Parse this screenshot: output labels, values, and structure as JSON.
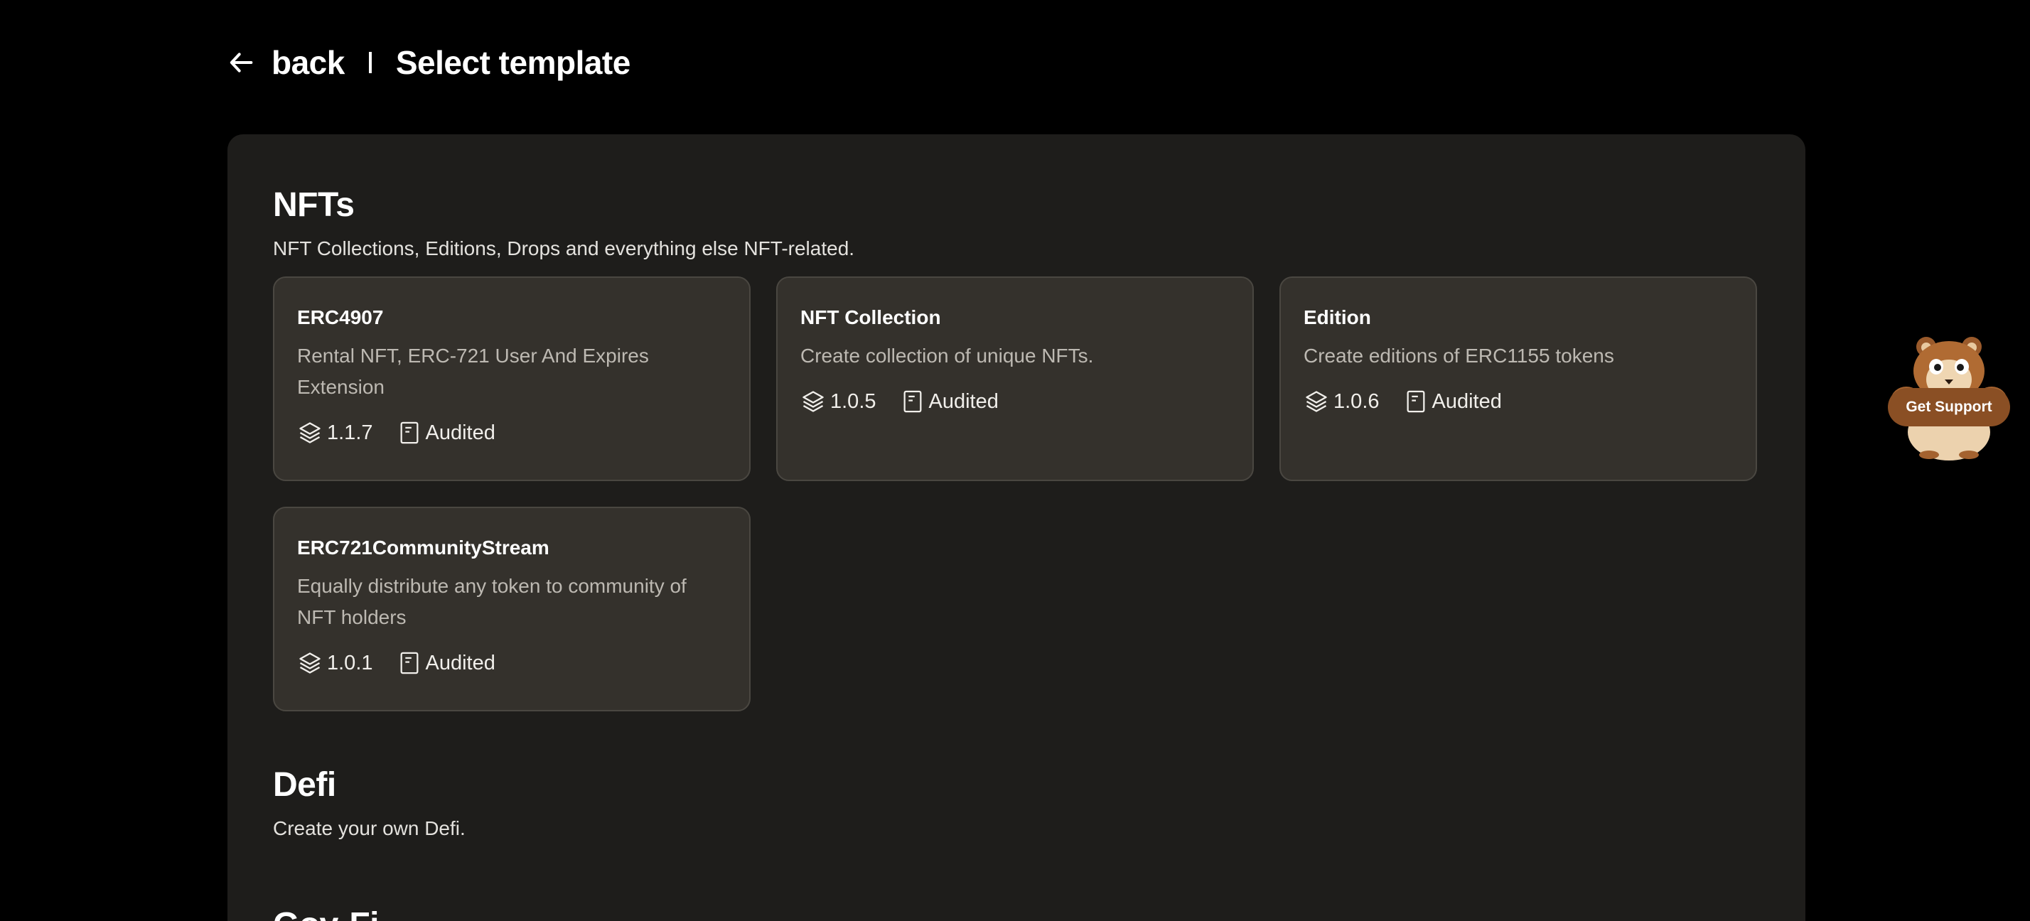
{
  "header": {
    "back_label": "back",
    "title": "Select template"
  },
  "sections": [
    {
      "title": "NFTs",
      "description": "NFT Collections, Editions, Drops and everything else NFT-related.",
      "cards": [
        {
          "title": "ERC4907",
          "description": "Rental NFT, ERC-721 User And Expires Extension",
          "version": "1.1.7",
          "audit": "Audited"
        },
        {
          "title": "NFT Collection",
          "description": "Create collection of unique NFTs.",
          "version": "1.0.5",
          "audit": "Audited"
        },
        {
          "title": "Edition",
          "description": "Create editions of ERC1155 tokens",
          "version": "1.0.6",
          "audit": "Audited"
        },
        {
          "title": "ERC721CommunityStream",
          "description": "Equally distribute any token to community of NFT holders",
          "version": "1.0.1",
          "audit": "Audited"
        }
      ]
    },
    {
      "title": "Defi",
      "description": "Create your own Defi."
    },
    {
      "title": "Gov-Fi"
    }
  ],
  "support": {
    "label": "Get Support"
  },
  "icons": {
    "back": "arrow-left-icon",
    "version": "layers-icon",
    "audit": "document-icon",
    "support": "hamster-mascot-icon"
  },
  "colors": {
    "background": "#000000",
    "panel": "#1e1d1b",
    "card": "#34312c",
    "card_border": "#4a4741",
    "support_button": "#8a4f24"
  }
}
